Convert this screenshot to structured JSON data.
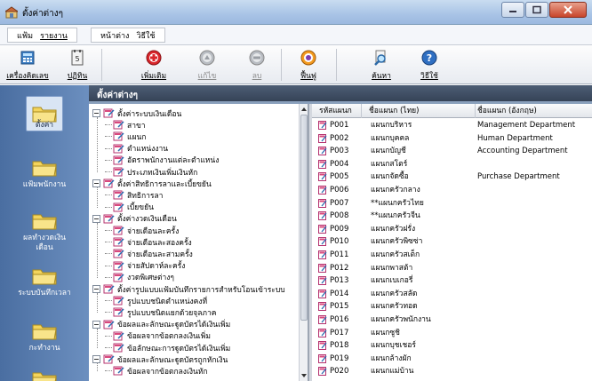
{
  "window": {
    "title": "ตั้งค่าต่างๆ"
  },
  "menu": {
    "left_group": [
      "แฟ้ม",
      "รายงาน"
    ],
    "right_group": [
      "หน้าต่าง",
      "วิธีใช้"
    ]
  },
  "toolbar": {
    "buttons": [
      {
        "label": "เครื่องคิดเลข",
        "icon": "calculator-icon",
        "enabled": true
      },
      {
        "label": "ปฏิทิน",
        "icon": "calendar-icon",
        "enabled": true
      },
      {
        "label": "เพิ่มเติม",
        "icon": "add-icon",
        "enabled": true
      },
      {
        "label": "แก้ไข",
        "icon": "edit-icon",
        "enabled": false
      },
      {
        "label": "ลบ",
        "icon": "delete-icon",
        "enabled": false
      },
      {
        "label": "ฟื้นฟู",
        "icon": "refresh-icon",
        "enabled": true
      },
      {
        "label": "ค้นหา",
        "icon": "search-icon",
        "enabled": true
      },
      {
        "label": "วิธีใช้",
        "icon": "help-icon",
        "enabled": true
      }
    ]
  },
  "sidebar": {
    "items": [
      {
        "label": "ตั้งค่า",
        "selected": true
      },
      {
        "label": "แฟ้มพนักงาน",
        "selected": false
      },
      {
        "label": "ผลทำงวดเงินเดือน",
        "selected": false
      },
      {
        "label": "ระบบบันทึกเวลา",
        "selected": false
      },
      {
        "label": "กะทำงาน",
        "selected": false
      }
    ]
  },
  "main": {
    "header": "ตั้งค่าต่างๆ"
  },
  "tree": {
    "nodes": [
      {
        "level": 0,
        "label": "ตั้งค่าระบบเงินเดือน"
      },
      {
        "level": 1,
        "label": "สาขา"
      },
      {
        "level": 1,
        "label": "แผนก"
      },
      {
        "level": 1,
        "label": "ตำแหน่งงาน"
      },
      {
        "level": 1,
        "label": "อัตราพนักงานแต่ละตำแหน่ง"
      },
      {
        "level": 1,
        "label": "ประเภทเงินเพิ่มเงินหัก"
      },
      {
        "level": 0,
        "label": "ตั้งค่าสิทธิการลาและเบี้ยขยัน"
      },
      {
        "level": 1,
        "label": "สิทธิการลา"
      },
      {
        "level": 1,
        "label": "เบี้ยขยัน"
      },
      {
        "level": 0,
        "label": "ตั้งค่างวดเงินเดือน"
      },
      {
        "level": 1,
        "label": "จ่ายเดือนละครั้ง"
      },
      {
        "level": 1,
        "label": "จ่ายเดือนละสองครั้ง"
      },
      {
        "level": 1,
        "label": "จ่ายเดือนละสามครั้ง"
      },
      {
        "level": 1,
        "label": "จ่ายสัปดาห์ละครั้ง"
      },
      {
        "level": 1,
        "label": "งวดพิเศษต่างๆ"
      },
      {
        "level": 0,
        "label": "ตั้งค่ารูปแบบแฟ้มบันทึกรายการสำหรับโอนเข้าระบบ"
      },
      {
        "level": 1,
        "label": "รูปแบบชนิดตำแหน่งคงที่"
      },
      {
        "level": 1,
        "label": "รูปแบบชนิดแยกด้วยจุลภาค"
      },
      {
        "level": 0,
        "label": "ข้อผลและลักษณะฐูดบัตรได้เงินเพิ่ม"
      },
      {
        "level": 1,
        "label": "ข้อผลจากข้อตกลงเงินเพิ่ม"
      },
      {
        "level": 1,
        "label": "ข้อลักษณะการฐูดบัตรได้เงินเพิ่ม"
      },
      {
        "level": 0,
        "label": "ข้อผลและลักษณะฐูดบัตรถูกหักเงิน"
      },
      {
        "level": 1,
        "label": "ข้อผลจากข้อตกลงเงินหัก"
      }
    ]
  },
  "grid": {
    "columns": [
      "รหัสแผนก",
      "ชื่อแผนก (ไทย)",
      "ชื่อแผนก (อังกฤษ)"
    ],
    "rows": [
      [
        "P001",
        "แผนกบริหาร",
        "Management Department"
      ],
      [
        "P002",
        "แผนกบุคคล",
        "Human Department"
      ],
      [
        "P003",
        "แผนกบัญชี",
        "Accounting Department"
      ],
      [
        "P004",
        "แผนกสโตร์",
        ""
      ],
      [
        "P005",
        "แผนกจัดซื้อ",
        "Purchase Department"
      ],
      [
        "P006",
        "แผนกครัวกลาง",
        ""
      ],
      [
        "P007",
        "**แผนกครัวไทย",
        ""
      ],
      [
        "P008",
        "**แผนกครัวจีน",
        ""
      ],
      [
        "P009",
        "แผนกครัวฝรั่ง",
        ""
      ],
      [
        "P010",
        "แผนกครัวพิซซ่า",
        ""
      ],
      [
        "P011",
        "แผนกครัวสเต็ก",
        ""
      ],
      [
        "P012",
        "แผนกพาสต้า",
        ""
      ],
      [
        "P013",
        "แผนกเบเกอรี่",
        ""
      ],
      [
        "P014",
        "แผนกครัวสลัด",
        ""
      ],
      [
        "P015",
        "แผนกครัวทอด",
        ""
      ],
      [
        "P016",
        "แผนกครัวพนักงาน",
        ""
      ],
      [
        "P017",
        "แผนกซูชิ",
        ""
      ],
      [
        "P018",
        "แผนกบุชเชอร์",
        ""
      ],
      [
        "P019",
        "แผนกล้างผัก",
        ""
      ],
      [
        "P020",
        "แผนกแม่บ้าน",
        ""
      ]
    ]
  }
}
